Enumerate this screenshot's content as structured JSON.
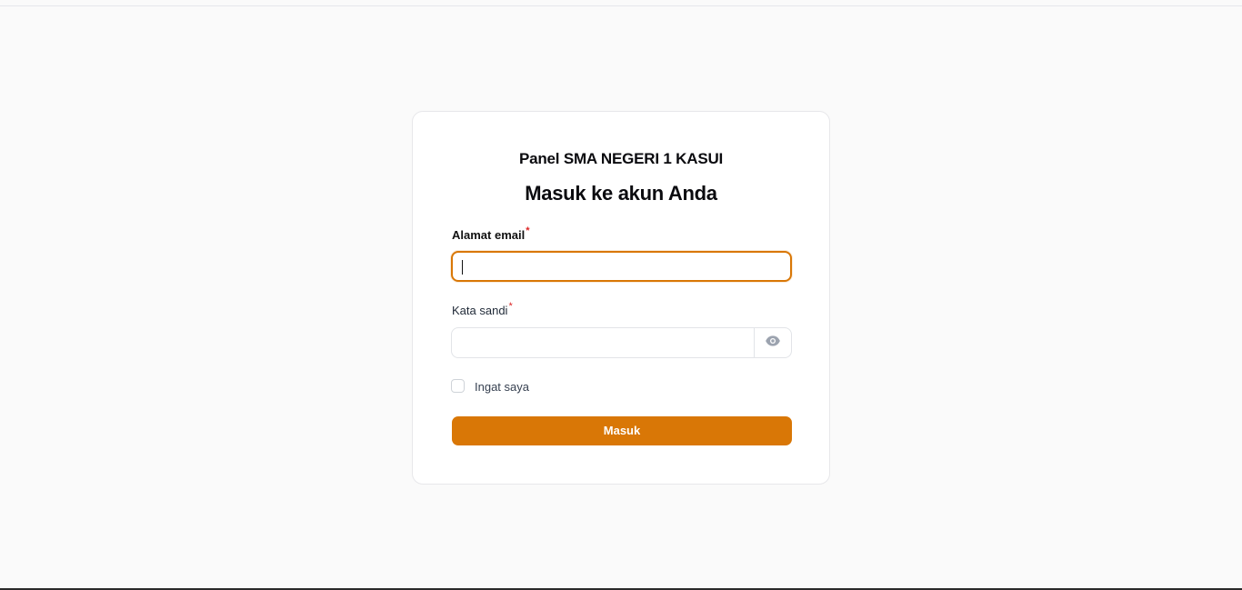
{
  "login": {
    "brand": "Panel SMA NEGERI 1 KASUI",
    "heading": "Masuk ke akun Anda",
    "email_label": "Alamat email",
    "email_value": "",
    "password_label": "Kata sandi",
    "password_value": "",
    "required_marker": "*",
    "remember_label": "Ingat saya",
    "remember_checked": false,
    "submit_label": "Masuk",
    "password_toggle_icon": "eye-icon"
  },
  "colors": {
    "accent": "#d97706",
    "required": "#dc2626",
    "background": "#fafafa",
    "card": "#ffffff"
  }
}
